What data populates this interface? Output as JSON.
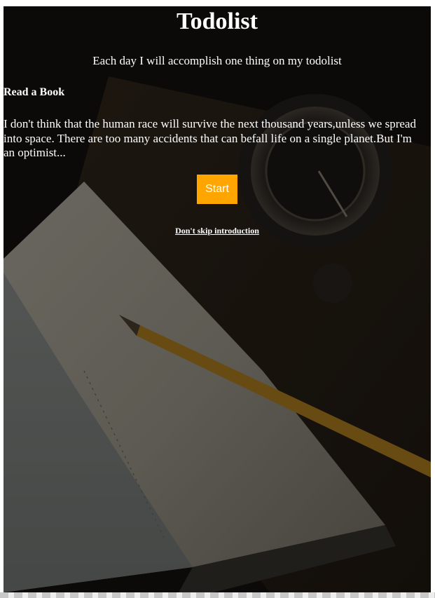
{
  "page": {
    "title": "Todolist",
    "subtitle": "Each day I will accomplish one thing on my todolist"
  },
  "task": {
    "heading": "Read a Book",
    "quote": "I don't think that the human race will survive the next thousand years,unless we spread into space. There are too many accidents that can befall life on a single planet.But I'm an optimist..."
  },
  "actions": {
    "start_label": "Start",
    "skip_label": "Don't skip introduction"
  },
  "colors": {
    "start_button": "#ffa500",
    "text": "#ffffff",
    "background": "#0d0c0b"
  }
}
